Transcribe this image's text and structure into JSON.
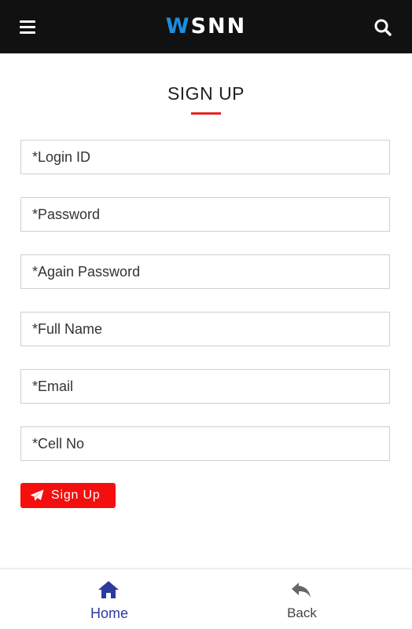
{
  "header": {
    "brand_accent": "W",
    "brand_rest": "SNN",
    "menu_icon": "hamburger-menu-icon",
    "search_icon": "search-icon"
  },
  "form": {
    "title": "SIGN UP",
    "fields": [
      {
        "placeholder": "*Login ID",
        "value": ""
      },
      {
        "placeholder": "*Password",
        "value": ""
      },
      {
        "placeholder": "*Again Password",
        "value": ""
      },
      {
        "placeholder": "*Full Name",
        "value": ""
      },
      {
        "placeholder": "*Email",
        "value": ""
      },
      {
        "placeholder": "*Cell No",
        "value": ""
      }
    ],
    "submit_label": "Sign Up",
    "submit_icon": "paper-plane-icon"
  },
  "bottom_nav": {
    "items": [
      {
        "label": "Home",
        "icon": "home-icon",
        "active": true
      },
      {
        "label": "Back",
        "icon": "back-arrow-icon",
        "active": false
      }
    ]
  },
  "colors": {
    "header_bg": "#111111",
    "brand_accent": "#1a8ee0",
    "title_underline": "#e52521",
    "button_bg": "#f40e0e",
    "nav_active": "#2b3a9e",
    "nav_inactive": "#666666"
  }
}
